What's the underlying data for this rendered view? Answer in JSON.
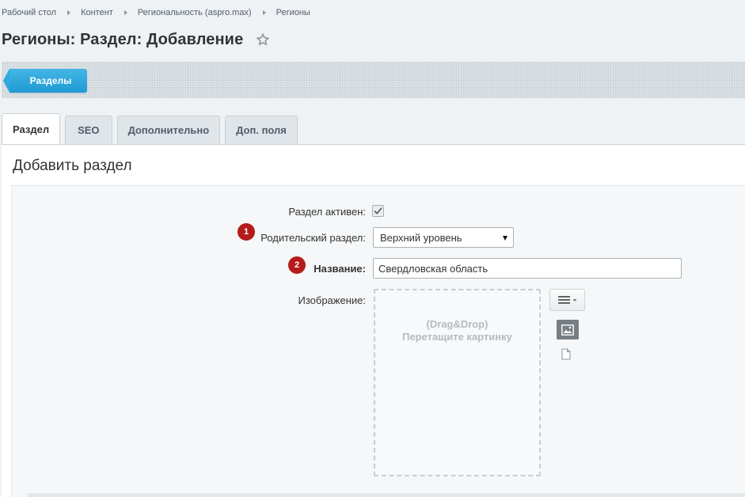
{
  "breadcrumbs": [
    "Рабочий стол",
    "Контент",
    "Региональность (aspro.max)",
    "Регионы"
  ],
  "page": {
    "title": "Регионы: Раздел: Добавление"
  },
  "toolbar": {
    "back_label": "Разделы"
  },
  "tabs": [
    {
      "label": "Раздел",
      "active": true
    },
    {
      "label": "SEO",
      "active": false
    },
    {
      "label": "Дополнительно",
      "active": false
    },
    {
      "label": "Доп. поля",
      "active": false
    }
  ],
  "section": {
    "title": "Добавить раздел"
  },
  "form": {
    "active_label": "Раздел активен:",
    "active_checked": true,
    "parent_label": "Родительский раздел:",
    "parent_value": "Верхний уровень",
    "name_label": "Название:",
    "name_value": "Свердловская область",
    "image_label": "Изображение:",
    "dropzone_line1": "(Drag&Drop)",
    "dropzone_line2": "Перетащите картинку"
  },
  "badges": {
    "parent": "1",
    "name": "2"
  },
  "icons": [
    "chevron-right-icon",
    "star-icon",
    "checkmark-icon",
    "dropdown-arrow-icon",
    "menu-icon",
    "image-icon",
    "file-icon"
  ],
  "colors": {
    "accent": "#1e9ad2",
    "badge": "#b51b1b",
    "toolbar": "#dce3e7",
    "background": "#eef2f4"
  }
}
